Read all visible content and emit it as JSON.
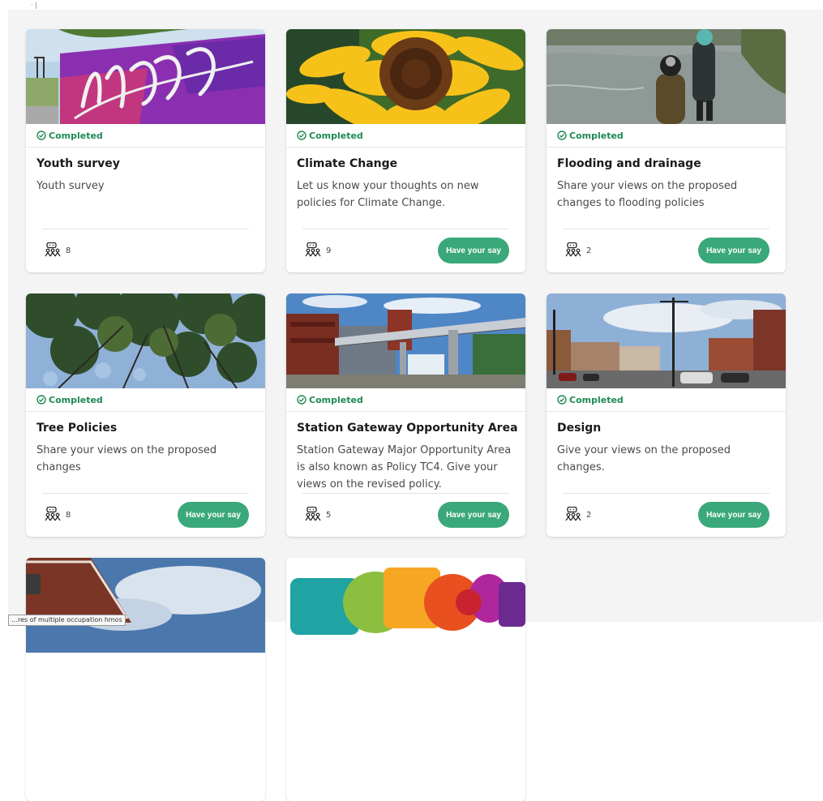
{
  "top_mark": "· |",
  "cards": [
    {
      "status": "Completed",
      "title": "Youth survey",
      "description": "Youth survey",
      "count": "8",
      "button": "",
      "image": "graffiti-wall"
    },
    {
      "status": "Completed",
      "title": "Climate Change",
      "description": "Let us know your thoughts on new policies for Climate Change.",
      "count": "9",
      "button": "Have your say",
      "image": "sunflower"
    },
    {
      "status": "Completed",
      "title": "Flooding and drainage",
      "description": "Share your views on the proposed changes to flooding policies",
      "count": "2",
      "button": "Have your say",
      "image": "flooded-riverbank"
    },
    {
      "status": "Completed",
      "title": "Tree Policies",
      "description": "Share your views on the proposed changes",
      "count": "8",
      "button": "Have your say",
      "image": "tree-canopy"
    },
    {
      "status": "Completed",
      "title": "Station Gateway Opportunity Area",
      "description": "Station Gateway Major Opportunity Area is also known as Policy TC4. Give your views on the revised policy.",
      "count": "5",
      "button": "Have your say",
      "image": "station-footbridge"
    },
    {
      "status": "Completed",
      "title": "Design",
      "description": "Give your views on the proposed changes.",
      "count": "2",
      "button": "Have your say",
      "image": "high-street"
    },
    {
      "image": "brick-building-sky"
    },
    {
      "image": "colorful-speech-bubbles"
    }
  ],
  "tooltip": "…res of multiple occupation hmos",
  "colors": {
    "accent": "#3aa87a",
    "completed": "#1e8a52",
    "card_bg": "#ffffff",
    "page_bg": "#f4f4f4"
  }
}
